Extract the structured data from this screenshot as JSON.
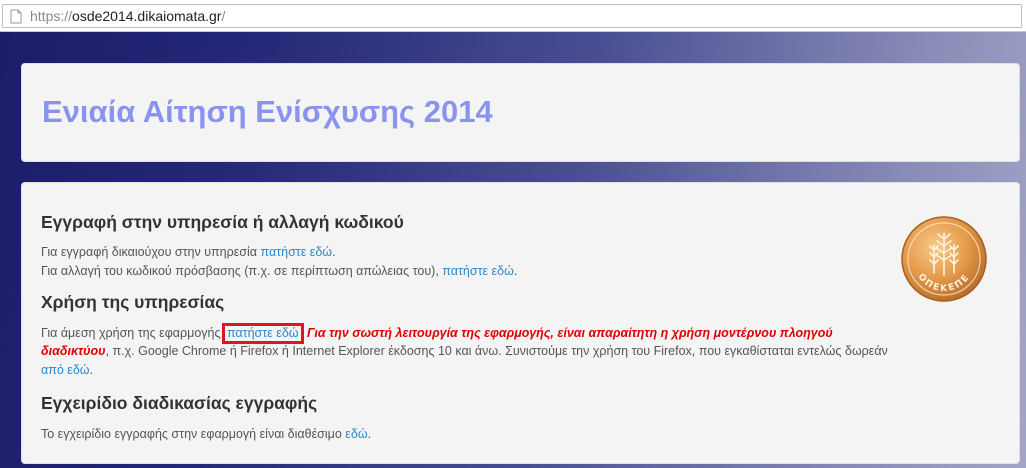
{
  "browser": {
    "url_scheme": "https://",
    "url_host": "osde2014.dikaiomata.gr",
    "url_path": "/"
  },
  "header": {
    "title": "Ενιαία Αίτηση Ενίσχυσης 2014"
  },
  "logo": {
    "text": "ΟΠΕΚΕΠΕ",
    "icon": "wheat-coin-icon"
  },
  "sections": {
    "registration": {
      "heading": "Εγγραφή στην υπηρεσία ή αλλαγή κωδικού",
      "line1_text": "Για εγγραφή δικαιούχου στην υπηρεσία ",
      "line1_link": "πατήστε εδώ",
      "line1_end": ".",
      "line2_text": "Για αλλαγή του κωδικού πρόσβασης (π.χ. σε περίπτωση απώλειας του), ",
      "line2_link": "πατήστε εδώ",
      "line2_end": "."
    },
    "usage": {
      "heading": "Χρήση της υπηρεσίας",
      "text_before": "Για άμεση χρήση της εφαρμογής ",
      "link": "πατήστε εδώ",
      "warning_part1": " Για την σωστή λειτουργία της εφαρμογής, είναι απαραίτητη η χρήση μοντέρνου πλοηγού",
      "warning_part2": "διαδικτύου",
      "text_after": ", π.χ. Google Chrome ή Firefox ή Internet Explorer έκδοσης 10 και άνω. Συνιστούμε την χρήση του Firefox, που εγκαθίσταται εντελώς δωρεάν",
      "download_link": "από εδώ",
      "download_end": "."
    },
    "manual": {
      "heading": "Εγχειρίδιο διαδικασίας εγγραφής",
      "text": "Το εγχειρίδιο εγγραφής στην εφαρμογή είναι διαθέσιμο ",
      "link": "εδώ",
      "end": "."
    }
  },
  "colors": {
    "title": "#8a93f0",
    "link": "#2a87c8",
    "warning": "#e00000",
    "highlight_border": "#e0161e"
  }
}
